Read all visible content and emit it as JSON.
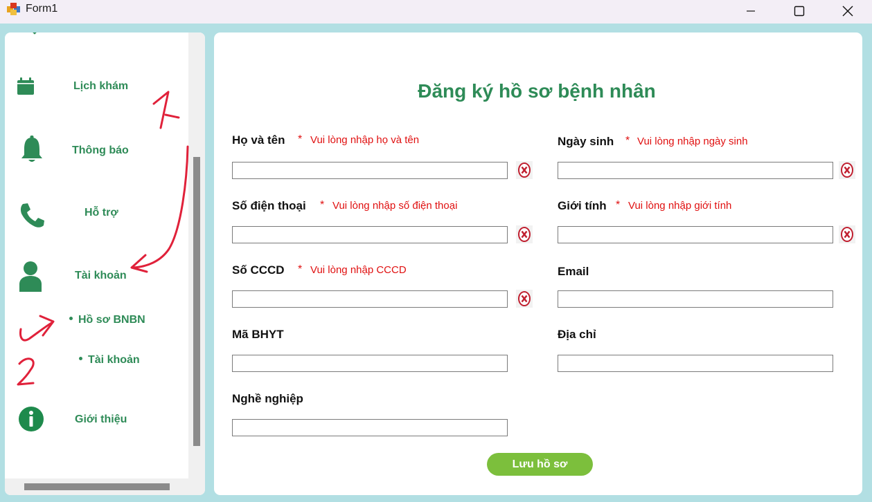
{
  "window": {
    "title": "Form1"
  },
  "sidebar": {
    "items": [
      {
        "label": "Lịch khám",
        "icon": "calendar-icon"
      },
      {
        "label": "Thông báo",
        "icon": "bell-icon"
      },
      {
        "label": "Hỗ trợ",
        "icon": "phone-icon"
      },
      {
        "label": "Tài khoản",
        "icon": "user-icon"
      },
      {
        "label": "Giới thiệu",
        "icon": "info-icon"
      }
    ],
    "subitems": [
      {
        "label": "Hồ sơ BNBN"
      },
      {
        "label": "Tài khoản"
      }
    ]
  },
  "annotations": {
    "arrow1": "1",
    "arrow2": "2"
  },
  "form": {
    "title": "Đăng ký hồ sơ bệnh nhân",
    "required_mark": "*",
    "fields": {
      "ho_ten": {
        "label": "Họ và tên",
        "error": "Vui lòng nhập họ và tên",
        "value": ""
      },
      "ngay_sinh": {
        "label": "Ngày sinh",
        "error": "Vui lòng nhập ngày sinh",
        "value": ""
      },
      "sdt": {
        "label": "Số điện thoại",
        "error": "Vui lòng nhập số điện thoại",
        "value": ""
      },
      "gioi_tinh": {
        "label": "Giới tính",
        "error": "Vui lòng nhập giới tính",
        "value": ""
      },
      "cccd": {
        "label": "Số CCCD",
        "error": "Vui lòng nhập CCCD",
        "value": ""
      },
      "email": {
        "label": "Email",
        "value": ""
      },
      "bhyt": {
        "label": "Mã BHYT",
        "value": ""
      },
      "dia_chi": {
        "label": "Địa chỉ",
        "value": ""
      },
      "nghe_nghiep": {
        "label": "Nghề nghiệp",
        "value": ""
      }
    },
    "save_label": "Lưu hồ sơ"
  },
  "colors": {
    "accent": "#2e8b57",
    "error": "#e01010",
    "button": "#7cbf3c",
    "background": "#b2dfe3"
  }
}
